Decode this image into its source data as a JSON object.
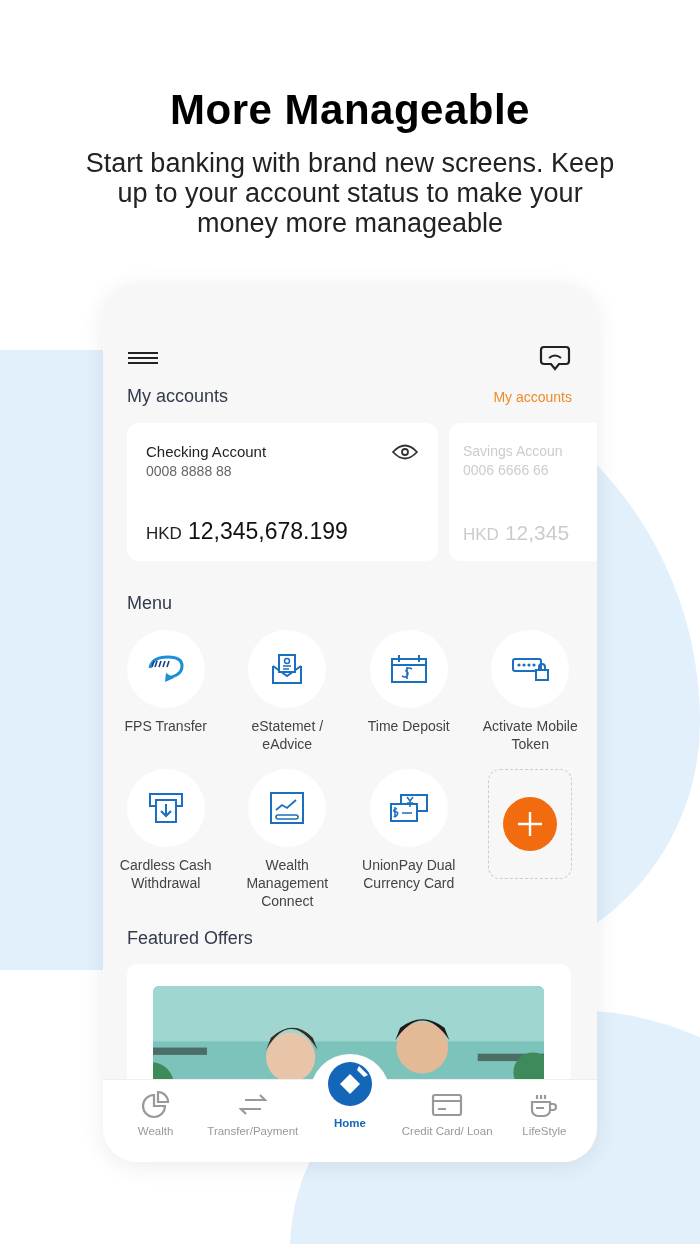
{
  "headline": "More Manageable",
  "subtitle": "Start banking with brand new screens. Keep up to your account status to make your money more manageable",
  "accounts_section": {
    "title": "My accounts",
    "link": "My accounts"
  },
  "accounts": [
    {
      "name": "Checking Account",
      "number": "0008 8888 88",
      "currency": "HKD",
      "balance": "12,345,678.199",
      "selected": true
    },
    {
      "name": "Savings Accoun",
      "number": "0006 6666 66",
      "currency": "HKD",
      "balance": "12,345",
      "selected": false
    }
  ],
  "menu": {
    "title": "Menu",
    "items": [
      {
        "label": "FPS Transfer"
      },
      {
        "label": "eStatemet / eAdvice"
      },
      {
        "label": "Time Deposit"
      },
      {
        "label": "Activate Mobile Token"
      },
      {
        "label": "Cardless Cash Withdrawal"
      },
      {
        "label": "Wealth Management Connect"
      },
      {
        "label": "UnionPay Dual Currency Card"
      }
    ]
  },
  "featured": {
    "title": "Featured Offers"
  },
  "nav": [
    {
      "label": "Wealth",
      "selected": false
    },
    {
      "label": "Transfer/Payment",
      "selected": false
    },
    {
      "label": "Home",
      "selected": true
    },
    {
      "label": "Credit Card/ Loan",
      "selected": false
    },
    {
      "label": "LifeStyle",
      "selected": false
    }
  ]
}
